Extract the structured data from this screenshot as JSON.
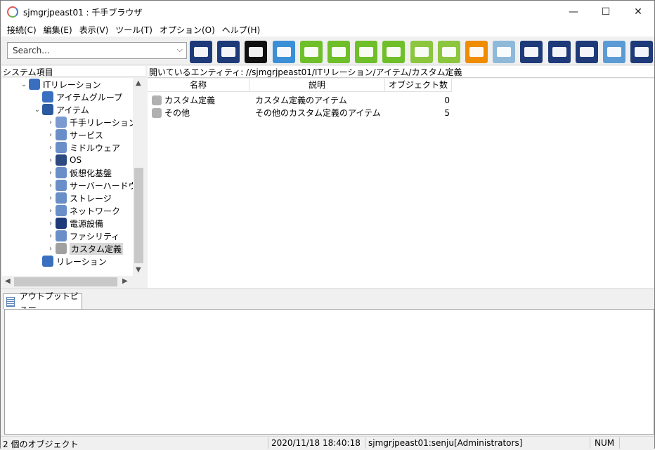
{
  "window": {
    "title": "sjmgrjpeast01 : 千手ブラウザ",
    "min": "—",
    "max": "☐",
    "close": "✕"
  },
  "menu": [
    "接続(C)",
    "編集(E)",
    "表示(V)",
    "ツール(T)",
    "オプション(O)",
    "ヘルプ(H)"
  ],
  "search": {
    "placeholder": "Search...",
    "chevron": "⌵"
  },
  "toolbar_buttons": [
    {
      "icon": "network-map-icon",
      "color": "#1e3a78"
    },
    {
      "icon": "monitor-icon",
      "color": "#1e3a78"
    },
    {
      "icon": "task-monitor-icon",
      "color": "#111111"
    },
    {
      "icon": "message-icon",
      "color": "#3b8fd6"
    },
    {
      "icon": "gear-map-icon",
      "color": "#6fbf2a"
    },
    {
      "icon": "check-map-icon",
      "color": "#6fbf2a"
    },
    {
      "icon": "puzzle-map-icon",
      "color": "#6fbf2a"
    },
    {
      "icon": "check-monitor-icon",
      "color": "#6fbf2a"
    },
    {
      "icon": "bar-report-icon",
      "color": "#8cc63f"
    },
    {
      "icon": "gantt-icon",
      "color": "#8cc63f"
    },
    {
      "icon": "chart-orange-icon",
      "color": "#f08c00"
    },
    {
      "icon": "camera-grid-icon",
      "color": "#8fb9d8"
    },
    {
      "icon": "gear-arrow-icon",
      "color": "#1e3a78"
    },
    {
      "icon": "check-arrow-icon",
      "color": "#1e3a78"
    },
    {
      "icon": "camera-arrow-icon",
      "color": "#1e3a78"
    },
    {
      "icon": "log-icon",
      "color": "#5b9bd5"
    },
    {
      "icon": "radar-icon",
      "color": "#1e3a78"
    }
  ],
  "left_panel": {
    "header": "システム項目",
    "tree": [
      {
        "label": "ITリレーション",
        "depth": 1,
        "expand": "⌄",
        "icon": "it-relation-icon",
        "color": "#3a6fc0"
      },
      {
        "label": "アイテムグループ",
        "depth": 2,
        "expand": "",
        "icon": "item-group-icon",
        "color": "#3a6fc0"
      },
      {
        "label": "アイテム",
        "depth": 2,
        "expand": "⌄",
        "icon": "toolbox-icon",
        "color": "#2c5aa0"
      },
      {
        "label": "千手リレーション",
        "depth": 3,
        "expand": "›",
        "icon": "senju-relation-icon",
        "color": "#7a9ad0"
      },
      {
        "label": "サービス",
        "depth": 3,
        "expand": "›",
        "icon": "gears-icon",
        "color": "#6a8fc8"
      },
      {
        "label": "ミドルウェア",
        "depth": 3,
        "expand": "›",
        "icon": "middleware-icon",
        "color": "#6a8fc8"
      },
      {
        "label": "OS",
        "depth": 3,
        "expand": "›",
        "icon": "os-icon",
        "color": "#2c4a80"
      },
      {
        "label": "仮想化基盤",
        "depth": 3,
        "expand": "›",
        "icon": "virtualization-icon",
        "color": "#6a8fc8"
      },
      {
        "label": "サーバーハードウェア",
        "depth": 3,
        "expand": "›",
        "icon": "server-icon",
        "color": "#6a8fc8"
      },
      {
        "label": "ストレージ",
        "depth": 3,
        "expand": "›",
        "icon": "storage-icon",
        "color": "#6a8fc8"
      },
      {
        "label": "ネットワーク",
        "depth": 3,
        "expand": "›",
        "icon": "network-icon",
        "color": "#6a8fc8"
      },
      {
        "label": "電源設備",
        "depth": 3,
        "expand": "›",
        "icon": "power-plug-icon",
        "color": "#1e3a78"
      },
      {
        "label": "ファシリティ",
        "depth": 3,
        "expand": "›",
        "icon": "facility-icon",
        "color": "#6a8fc8"
      },
      {
        "label": "カスタム定義",
        "depth": 3,
        "expand": "›",
        "icon": "custom-wrench-icon",
        "color": "#a0a0a0",
        "selected": true
      },
      {
        "label": "リレーション",
        "depth": 2,
        "expand": "",
        "icon": "relation-shield-icon",
        "color": "#3a6fc0"
      }
    ]
  },
  "right_panel": {
    "header": "開いているエンティティ: //sjmgrjpeast01/ITリレーション/アイテム/カスタム定義",
    "columns": [
      "名称",
      "説明",
      "オブジェクト数"
    ],
    "rows": [
      {
        "name": "カスタム定義",
        "desc": "カスタム定義のアイテム",
        "count": "0",
        "icon": "custom-wrench-icon"
      },
      {
        "name": "その他",
        "desc": "その他のカスタム定義のアイテム",
        "count": "5",
        "icon": "other-wrench-icon"
      }
    ]
  },
  "output": {
    "tab": "アウトプットビュー"
  },
  "status": {
    "objects": "2 個のオブジェクト",
    "datetime": "2020/11/18 18:40:18",
    "user": "sjmgrjpeast01:senju[Administrators]",
    "num": "NUM"
  }
}
